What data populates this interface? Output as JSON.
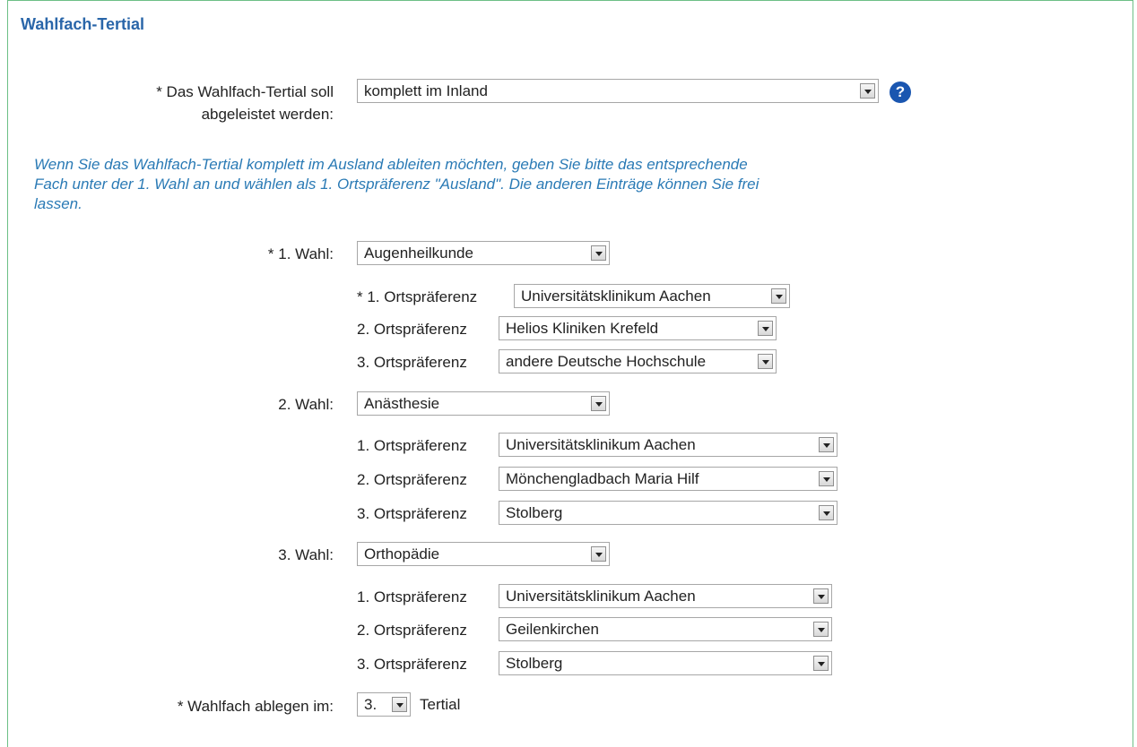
{
  "section_title": "Wahlfach-Tertial",
  "mode": {
    "label_line1": "* Das Wahlfach-Tertial soll",
    "label_line2": "abgeleistet werden:",
    "value": "komplett im Inland",
    "help_icon": "?"
  },
  "hint": "Wenn Sie das Wahlfach-Tertial komplett im Ausland ableiten möchten, geben Sie bitte das entsprechende Fach unter der 1. Wahl an und wählen als 1. Ortspräferenz \"Ausland\". Die anderen Einträge können Sie frei lassen.",
  "choices": [
    {
      "label": "* 1. Wahl:",
      "subject": "Augenheilkunde",
      "preferences": [
        {
          "label": "* 1. Ortspräferenz",
          "value": "Universitätsklinikum Aachen"
        },
        {
          "label": "2. Ortspräferenz",
          "value": "Helios Kliniken Krefeld"
        },
        {
          "label": "3. Ortspräferenz",
          "value": "andere Deutsche Hochschule"
        }
      ]
    },
    {
      "label": "2. Wahl:",
      "subject": "Anästhesie",
      "preferences": [
        {
          "label": "1. Ortspräferenz",
          "value": "Universitätsklinikum Aachen"
        },
        {
          "label": "2. Ortspräferenz",
          "value": "Mönchengladbach Maria Hilf"
        },
        {
          "label": "3. Ortspräferenz",
          "value": "Stolberg"
        }
      ]
    },
    {
      "label": "3. Wahl:",
      "subject": "Orthopädie",
      "preferences": [
        {
          "label": "1. Ortspräferenz",
          "value": "Universitätsklinikum Aachen"
        },
        {
          "label": "2. Ortspräferenz",
          "value": "Geilenkirchen"
        },
        {
          "label": "3. Ortspräferenz",
          "value": "Stolberg"
        }
      ]
    }
  ],
  "tertial": {
    "label": "* Wahlfach ablegen im:",
    "value": "3.",
    "suffix": "Tertial"
  }
}
